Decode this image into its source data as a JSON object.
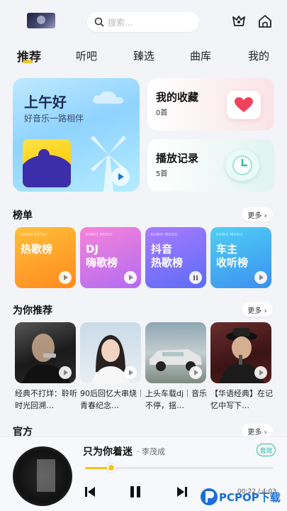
{
  "header": {
    "search_placeholder": "搜索...",
    "icons": [
      "avatar",
      "search-icon",
      "vip-icon",
      "home-icon"
    ]
  },
  "tabs": [
    {
      "label": "推荐",
      "active": true
    },
    {
      "label": "听吧",
      "active": false
    },
    {
      "label": "臻选",
      "active": false
    },
    {
      "label": "曲库",
      "active": false
    },
    {
      "label": "我的",
      "active": false
    }
  ],
  "hero": {
    "title": "上午好",
    "subtitle": "好音乐一路相伴"
  },
  "favorites": {
    "title": "我的收藏",
    "count": "0首"
  },
  "history": {
    "title": "播放记录",
    "count": "5首"
  },
  "charts_section": {
    "title": "榜单",
    "more": "更多 ›"
  },
  "charts": [
    {
      "tag": "KUWO MUSIC",
      "name": "热歌榜",
      "state": "play",
      "color_top": "#ffbf3b",
      "color_bottom": "#ff8a1d"
    },
    {
      "tag": "KUWO MUSIC",
      "name": "DJ\n嗨歌榜",
      "state": "play",
      "color_top": "#f783d9",
      "color_bottom": "#b26cf2"
    },
    {
      "tag": "KUWO MUSIC",
      "name": "抖音\n热歌榜",
      "state": "pause",
      "color_top": "#a97bff",
      "color_bottom": "#5b6cf5"
    },
    {
      "tag": "KUWO MUSIC",
      "name": "车主\n收听榜",
      "state": "play",
      "color_top": "#50d0f5",
      "color_bottom": "#3b8ff0"
    }
  ],
  "recommend_section": {
    "title": "为你推荐",
    "more": "更多 ›"
  },
  "recommend": [
    {
      "title": "经典不打烊：聆听时光回溯…"
    },
    {
      "title": "90后回忆大串烧｜青春纪念…"
    },
    {
      "title": "上头车载dj｜音乐不停，揺…"
    },
    {
      "title": "【华语经典】在记忆中写下…"
    }
  ],
  "official_section": {
    "title": "官方",
    "more": "更多 ›"
  },
  "player": {
    "song": "只为你着迷",
    "artist": "· 李茂成",
    "quality": "音效",
    "time": "00:22 / 4:03",
    "progress": 0.14
  },
  "watermark": "PCPOP下载"
}
